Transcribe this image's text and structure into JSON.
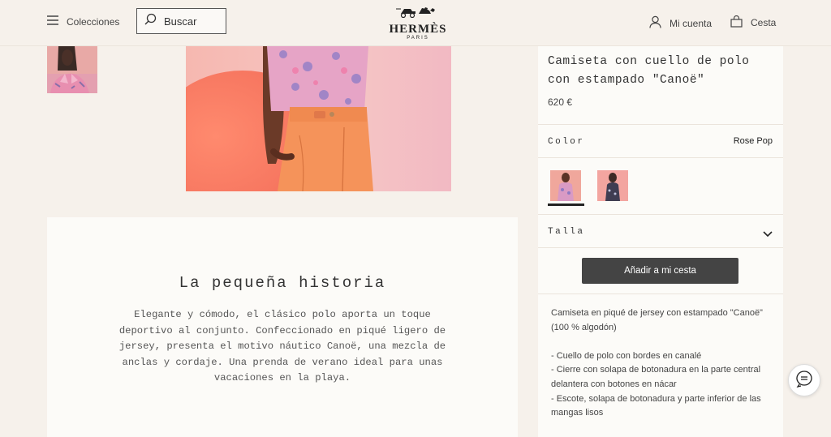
{
  "header": {
    "menu_label": "Colecciones",
    "search_placeholder": "Buscar",
    "logo_brand": "HERMÈS",
    "logo_city": "PARIS",
    "account_label": "Mi cuenta",
    "cart_label": "Cesta"
  },
  "story": {
    "title": "La pequeña historia",
    "body": "Elegante y cómodo, el clásico polo aporta un toque deportivo al conjunto. Confeccionado en piqué ligero de jersey, presenta el motivo náutico Canoë, una mezcla de anclas y cordaje. Una prenda de verano ideal para unas vacaciones en la playa."
  },
  "product": {
    "title": "Camiseta con cuello de polo con estampado \"Canoë\"",
    "price": "620 €",
    "color_label": "Color",
    "color_value": "Rose Pop",
    "size_label": "Talla",
    "add_button": "Añadir a mi cesta",
    "description": [
      "Camiseta en piqué de jersey con estampado \"Canoë\" (100 % algodón)",
      "",
      "- Cuello de polo con bordes en canalé",
      "- Cierre con solapa de botonadura en la parte central delantera con botones en nácar",
      "- Escote, solapa de botonadura y parte inferior de las mangas lisos"
    ]
  },
  "colors": {
    "background": "#f6f1eb",
    "panel": "#fcfbf8",
    "button": "#444444",
    "text": "#222222"
  },
  "icons": {
    "menu": "hamburger-icon",
    "search": "search-icon",
    "account": "user-icon",
    "cart": "bag-icon",
    "size": "chevron-down-icon",
    "chat": "chat-icon"
  }
}
